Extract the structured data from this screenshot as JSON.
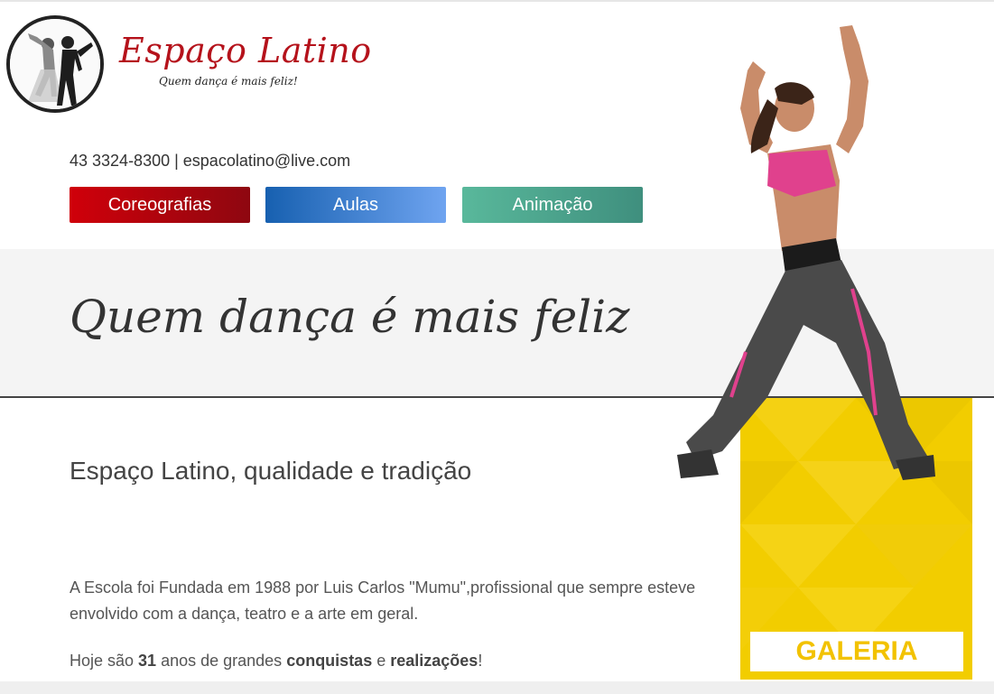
{
  "logo": {
    "title": "Espaço Latino",
    "tagline": "Quem dança é mais feliz!"
  },
  "contact": {
    "text": "43 3324-8300 | espacolatino@live.com"
  },
  "nav": {
    "items": [
      {
        "label": "Coreografias"
      },
      {
        "label": "Aulas"
      },
      {
        "label": "Animação"
      }
    ]
  },
  "band": {
    "slogan": "Quem dança é mais feliz"
  },
  "main": {
    "heading": "Espaço Latino, qualidade e tradição",
    "paragraph": "A Escola foi Fundada em 1988 por Luis Carlos \"Mumu\",profissional que sempre esteve envolvido com a dança, teatro e a arte em geral.",
    "line2": {
      "p1": "Hoje são ",
      "years": "31",
      "p2": " anos de grandes ",
      "w1": "conquistas",
      "p3": " e ",
      "w2": "realizações",
      "p4": "!"
    }
  },
  "gallery": {
    "label": "GALERIA"
  },
  "colors": {
    "brand_red": "#b5121b",
    "btn_red": "#d0000a",
    "btn_blue": "#1760b0",
    "btn_green": "#59b89b",
    "gallery_yellow": "#f2cd00"
  },
  "icons": [
    "dancing-couple-logo",
    "dancer-photo"
  ]
}
